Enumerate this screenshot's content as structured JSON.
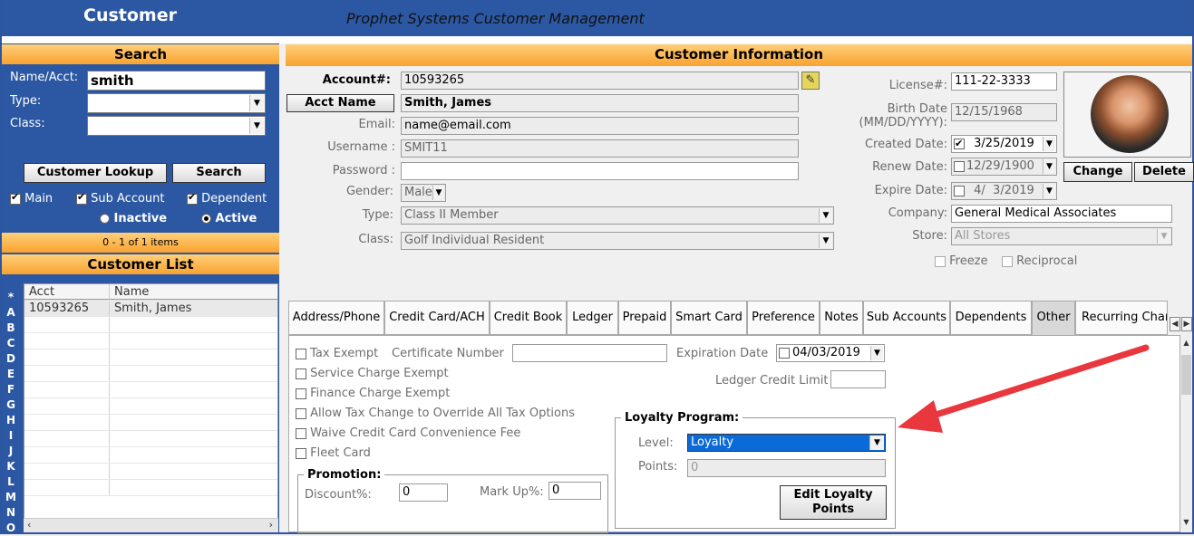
{
  "app": {
    "title": "Customer",
    "subtitle": "Prophet Systems Customer Management"
  },
  "search": {
    "header": "Search",
    "name_label": "Name/Acct:",
    "name_value": "smith",
    "type_label": "Type:",
    "type_value": "",
    "class_label": "Class:",
    "class_value": "",
    "lookup_button": "Customer Lookup",
    "search_button": "Search",
    "checks": [
      {
        "label": "Main",
        "checked": true
      },
      {
        "label": "Sub Account",
        "checked": true
      },
      {
        "label": "Dependent",
        "checked": true
      }
    ],
    "radios": [
      {
        "label": "Inactive",
        "selected": false
      },
      {
        "label": "Active",
        "selected": true
      }
    ],
    "count_text": "0 - 1 of 1 items"
  },
  "customer_list": {
    "header": "Customer List",
    "columns": [
      "Acct",
      "Name"
    ],
    "rows": [
      {
        "acct": "10593265",
        "name": "Smith, James"
      }
    ],
    "alphabet": [
      "*",
      "A",
      "B",
      "C",
      "D",
      "E",
      "F",
      "G",
      "H",
      "I",
      "J",
      "K",
      "L",
      "M",
      "N",
      "O"
    ]
  },
  "info": {
    "header": "Customer Information",
    "account_label": "Account#:",
    "account_value": "10593265",
    "acct_name_button": "Acct Name",
    "acct_name_value": "Smith, James",
    "email_label": "Email:",
    "email_value": "name@email.com",
    "username_label": "Username :",
    "username_value": "SMIT11",
    "password_label": "Password :",
    "password_value": "",
    "gender_label": "Gender:",
    "gender_value": "Male",
    "type_label": "Type:",
    "type_value": "Class II Member",
    "class_label": "Class:",
    "class_value": "Golf Individual Resident",
    "license_label": "License#:",
    "license_value": "111-22-3333",
    "birth_label_1": "Birth Date",
    "birth_label_2": "(MM/DD/YYYY):",
    "birth_value": "12/15/1968",
    "created_label": "Created Date:",
    "created_value": "3/25/2019",
    "created_checked": true,
    "renew_label": "Renew Date:",
    "renew_value": "12/29/1900",
    "renew_checked": false,
    "expire_label": "Expire Date:",
    "expire_value": "4/  3/2019",
    "expire_checked": false,
    "company_label": "Company:",
    "company_value": "General Medical Associates",
    "store_label": "Store:",
    "store_value": "All Stores",
    "freeze_label": "Freeze",
    "reciprocal_label": "Reciprocal",
    "change_button": "Change",
    "delete_button": "Delete"
  },
  "tabs": [
    {
      "label": "Address/Phone"
    },
    {
      "label": "Credit Card/ACH"
    },
    {
      "label": "Credit Book"
    },
    {
      "label": "Ledger"
    },
    {
      "label": "Prepaid"
    },
    {
      "label": "Smart Card"
    },
    {
      "label": "Preference"
    },
    {
      "label": "Notes"
    },
    {
      "label": "Sub Accounts"
    },
    {
      "label": "Dependents"
    },
    {
      "label": "Other",
      "active": true
    },
    {
      "label": "Recurring Charg"
    }
  ],
  "other": {
    "tax_exempt": "Tax Exempt",
    "cert_label": "Certificate Number",
    "cert_value": "",
    "exp_label": "Expiration Date",
    "exp_value": "04/03/2019",
    "service_charge": "Service Charge Exempt",
    "finance_charge": "Finance Charge Exempt",
    "allow_tax": "Allow Tax Change to Override All Tax Options",
    "waive_fee": "Waive Credit Card Convenience Fee",
    "fleet_card": "Fleet Card",
    "ledger_credit_label": "Ledger Credit Limit",
    "ledger_credit_value": "",
    "promotion_title": "Promotion:",
    "discount_label": "Discount%:",
    "discount_value": "0",
    "markup_label": "Mark Up%:",
    "markup_value": "0",
    "loyalty_title": "Loyalty Program:",
    "level_label": "Level:",
    "level_value": "Loyalty",
    "points_label": "Points:",
    "points_value": "0",
    "edit_loyalty_line1": "Edit Loyalty",
    "edit_loyalty_line2": "Points"
  },
  "colors": {
    "header_blue": "#2c58a3",
    "orange": "#f9a230",
    "annotation_arrow": "#e8383d",
    "selected_blue": "#0a6bd8"
  }
}
